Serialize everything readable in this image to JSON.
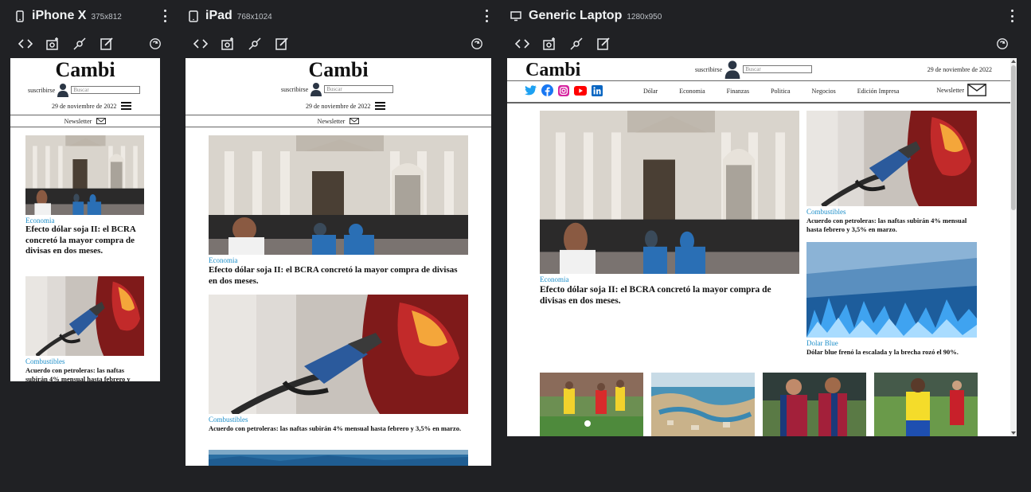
{
  "devices": [
    {
      "name": "iPhone X",
      "dims": "375x812"
    },
    {
      "name": "iPad",
      "dims": "768x1024"
    },
    {
      "name": "Generic Laptop",
      "dims": "1280x950"
    }
  ],
  "site": {
    "logo": "Cambi",
    "subscribe": "suscribirse",
    "search_placeholder": "Buscar",
    "date": "29 de noviembre de 2022",
    "newsletter": "Newsletter",
    "nav": [
      "Dólar",
      "Economia",
      "Finanzas",
      "Politica",
      "Negocios",
      "Edición Impresa"
    ],
    "articles": [
      {
        "category": "Economia",
        "title": "Efecto dólar soja II: el BCRA concretó la mayor compra de divisas en dos meses."
      },
      {
        "category": "Combustibles",
        "title": "Acuerdo con petroleras: las naftas subirán 4% mensual hasta febrero y 3,5% en marzo."
      },
      {
        "category": "Dolar Blue",
        "title": "Dólar blue frenó la escalada y la brecha rozó el 90%."
      }
    ]
  },
  "colors": {
    "accent": "#1f8fc9",
    "background": "#202124",
    "twitter": "#1da1f2",
    "facebook": "#1877f2",
    "instagram": "#d6249f",
    "youtube": "#ff0000",
    "linkedin": "#0a66c2"
  }
}
